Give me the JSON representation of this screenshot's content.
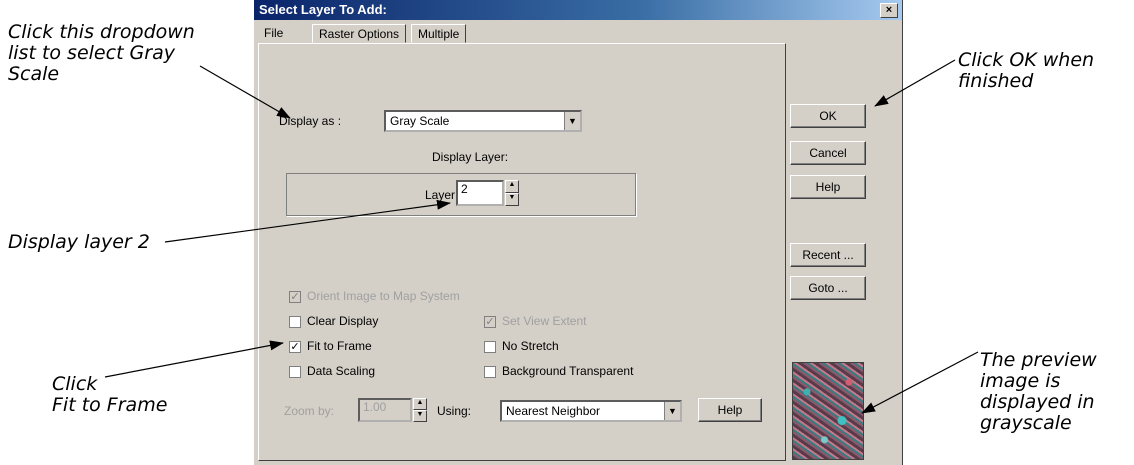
{
  "annotations": {
    "dropdown": "Click this dropdown\nlist to select Gray\nScale",
    "layer": "Display layer 2",
    "fit": "Click\nFit to Frame",
    "ok": "Click OK when\nfinished",
    "preview": "The preview\nimage is\ndisplayed in\ngrayscale"
  },
  "dialog": {
    "title": "Select Layer To Add:",
    "close": "×",
    "tabs": [
      "File",
      "Raster Options",
      "Multiple"
    ],
    "display_as_label": "Display as :",
    "display_as_value": "Gray Scale",
    "display_layer_label": "Display Layer:",
    "layer_label": "Layer:",
    "layer_value": "2",
    "checkboxes": {
      "orient": "Orient Image to Map System",
      "clear": "Clear Display",
      "set_view": "Set View Extent",
      "fit": "Fit to Frame",
      "no_stretch": "No Stretch",
      "data_scaling": "Data Scaling",
      "bg_transparent": "Background Transparent"
    },
    "zoom_label": "Zoom by:",
    "zoom_value": "1.00",
    "using_label": "Using:",
    "using_value": "Nearest Neighbor",
    "help_small": "Help",
    "buttons": {
      "ok": "OK",
      "cancel": "Cancel",
      "help": "Help",
      "recent": "Recent ...",
      "goto": "Goto ..."
    }
  },
  "check_glyph": "✓",
  "arrow_glyph": "▼"
}
